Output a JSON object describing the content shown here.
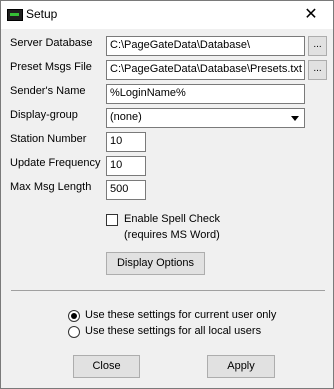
{
  "window": {
    "title": "Setup",
    "close_glyph": "✕"
  },
  "fields": {
    "server_database": {
      "label": "Server Database",
      "value": "C:\\PageGateData\\Database\\",
      "browse": "..."
    },
    "preset_msgs_file": {
      "label": "Preset Msgs File",
      "value": "C:\\PageGateData\\Database\\Presets.txt",
      "browse": "..."
    },
    "senders_name": {
      "label": "Sender's Name",
      "value": "%LoginName%"
    },
    "display_group": {
      "label": "Display-group",
      "value": "(none)"
    },
    "station_number": {
      "label": "Station Number",
      "value": "10"
    },
    "update_frequency": {
      "label": "Update Frequency",
      "value": "10"
    },
    "max_msg_length": {
      "label": "Max Msg Length",
      "value": "500"
    }
  },
  "spell_check": {
    "label": "Enable Spell Check",
    "note": "(requires MS Word)",
    "checked": false
  },
  "buttons": {
    "display_options": "Display Options",
    "close": "Close",
    "apply": "Apply"
  },
  "scope": {
    "options": [
      {
        "label": "Use these settings for current user only",
        "selected": true
      },
      {
        "label": "Use these settings for all local users",
        "selected": false
      }
    ]
  }
}
